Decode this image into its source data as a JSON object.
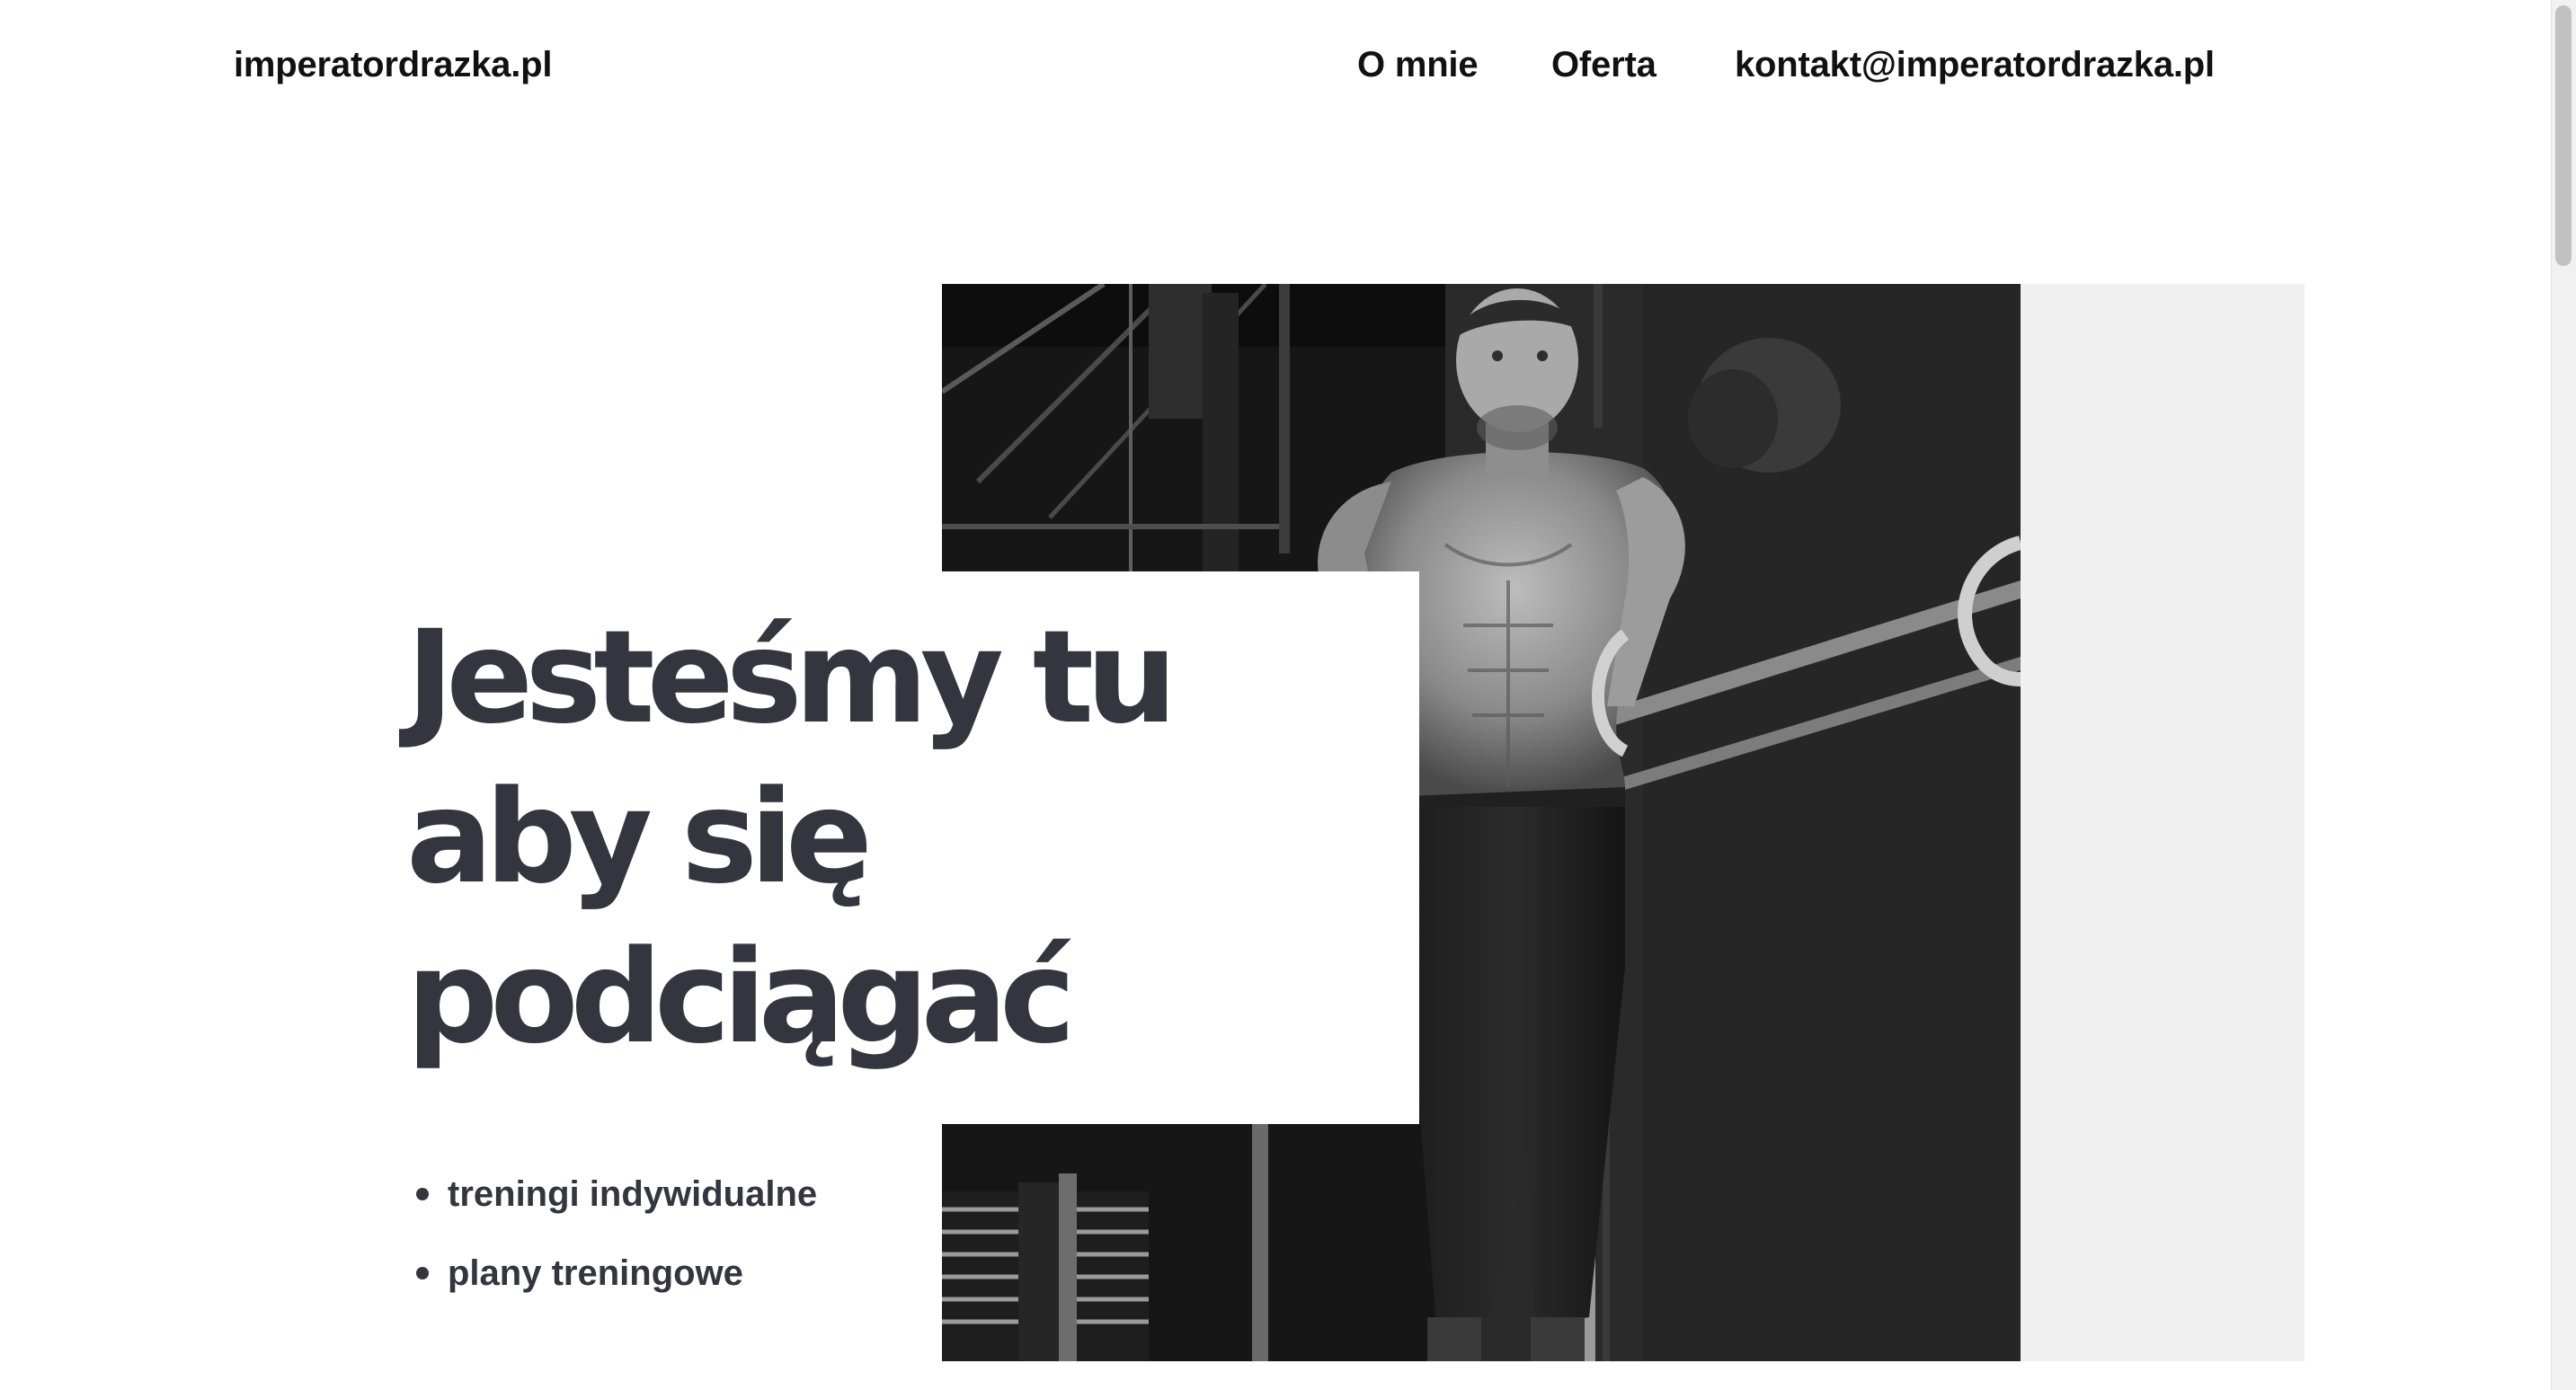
{
  "header": {
    "logo": "imperatordrazka.pl",
    "nav": {
      "about": "O mnie",
      "offer": "Oferta",
      "contact": "kontakt@imperatordrazka.pl"
    }
  },
  "hero": {
    "headline": [
      "Jesteśmy tu",
      "aby się",
      "podciągać"
    ],
    "features": [
      "treningi indywidualne",
      "plany treningowe"
    ],
    "photo_icon": "athlete-photo-icon"
  },
  "colors": {
    "text_dark": "#33363f",
    "nav_text": "#111111",
    "panel_gray": "#f0f0f0"
  }
}
